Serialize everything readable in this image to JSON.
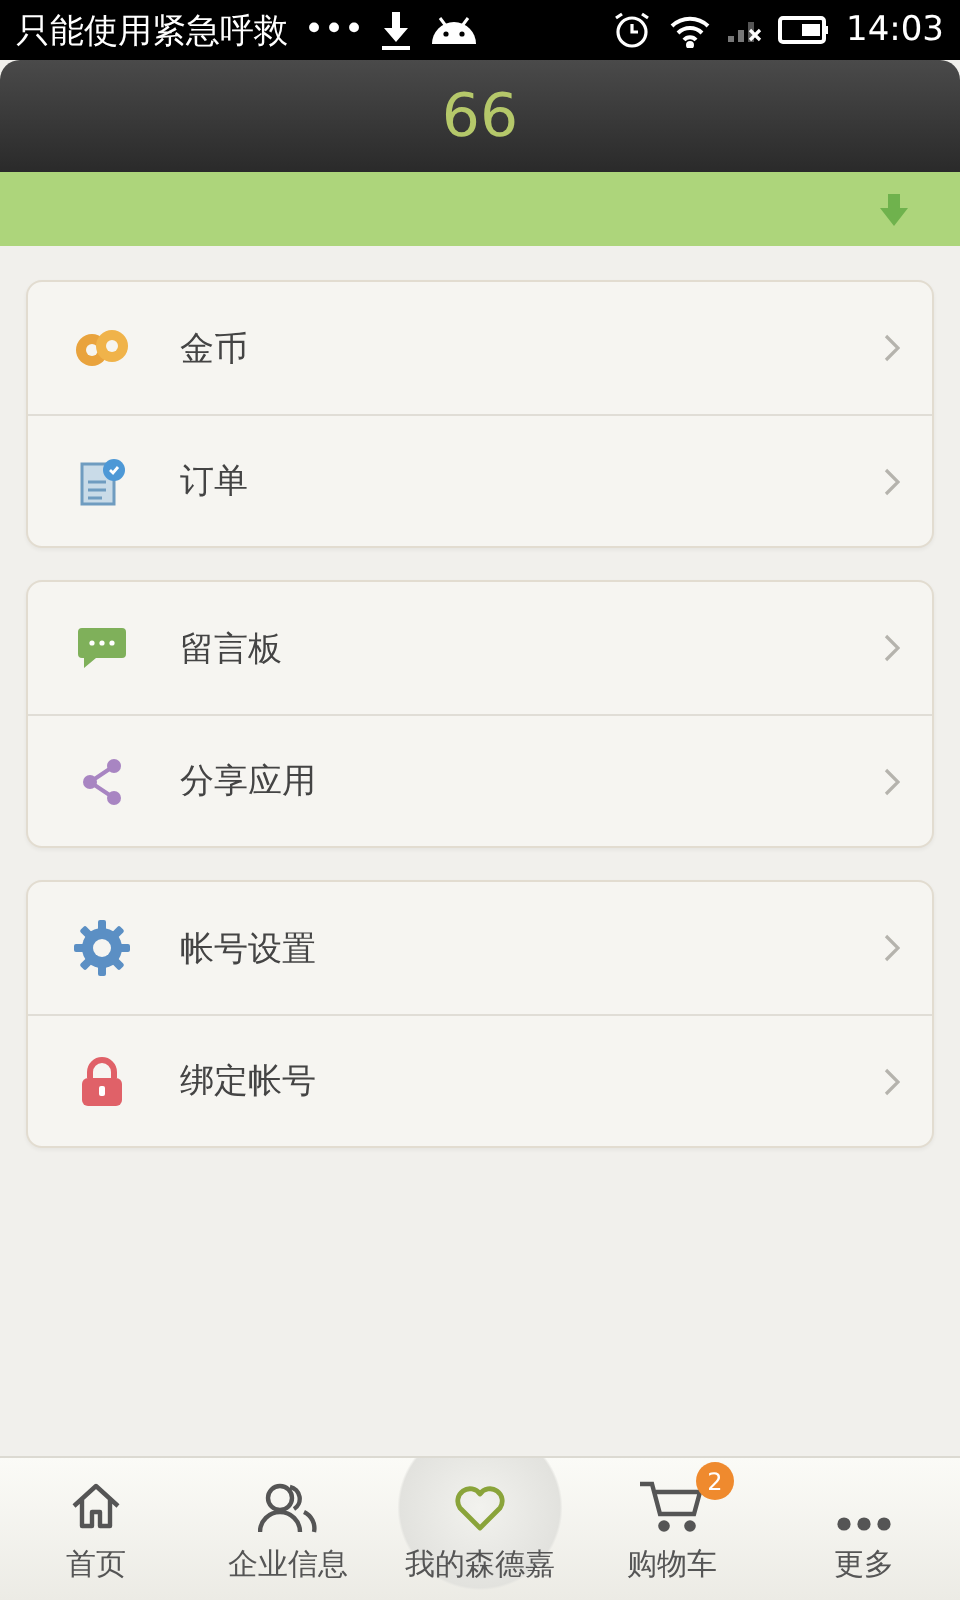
{
  "status_bar": {
    "notification": "只能使用紧急呼救",
    "more": "•••",
    "time": "14:03"
  },
  "header": {
    "title": "66"
  },
  "menu_groups": [
    {
      "items": [
        {
          "kind": "coins",
          "label": "金币"
        },
        {
          "kind": "order",
          "label": "订单"
        }
      ]
    },
    {
      "items": [
        {
          "kind": "message",
          "label": "留言板"
        },
        {
          "kind": "share",
          "label": "分享应用"
        }
      ]
    },
    {
      "items": [
        {
          "kind": "settings",
          "label": "帐号设置"
        },
        {
          "kind": "lock",
          "label": "绑定帐号"
        }
      ]
    }
  ],
  "tab_bar": [
    {
      "kind": "home",
      "label": "首页",
      "selected": false
    },
    {
      "kind": "people",
      "label": "企业信息",
      "selected": false
    },
    {
      "kind": "heart",
      "label": "我的森德嘉",
      "selected": true
    },
    {
      "kind": "cart",
      "label": "购物车",
      "selected": false,
      "badge": "2"
    },
    {
      "kind": "more",
      "label": "更多",
      "selected": false
    }
  ]
}
